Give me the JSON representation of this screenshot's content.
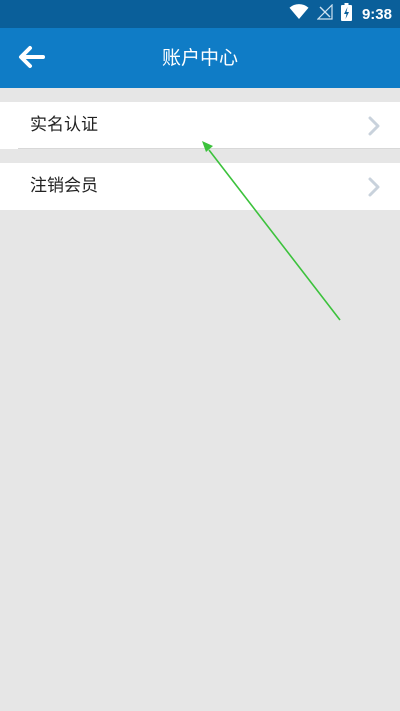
{
  "status_bar": {
    "time": "9:38",
    "icons": [
      "wifi-icon",
      "no-signal-icon",
      "battery-charging-icon"
    ]
  },
  "toolbar": {
    "title": "账户中心",
    "back_icon": "arrow-left-icon"
  },
  "menu": {
    "items": [
      {
        "label": "实名认证",
        "icon": "chevron-right-icon"
      },
      {
        "label": "注销会员",
        "icon": "chevron-right-icon"
      }
    ]
  },
  "colors": {
    "status_bar": "#0a5f9a",
    "toolbar": "#0f7cc6",
    "background": "#e6e6e6",
    "annotation_arrow": "#3cc23c"
  }
}
